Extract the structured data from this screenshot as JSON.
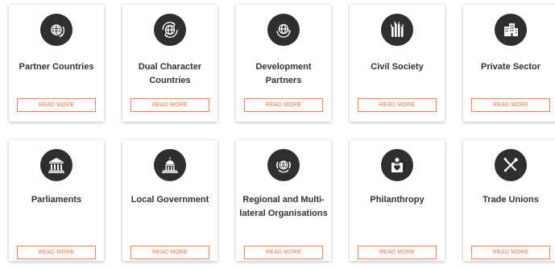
{
  "accent_color": "#ee6b3b",
  "icon_bg_color": "#2f2f2f",
  "cards": [
    {
      "title": "Partner Countries",
      "button": "READ MORE",
      "icon": "globe-refresh-icon"
    },
    {
      "title": "Dual Character Countries",
      "button": "READ MORE",
      "icon": "globe-cycle-icon"
    },
    {
      "title": "Development Partners",
      "button": "READ MORE",
      "icon": "globe-arrow-icon"
    },
    {
      "title": "Civil Society",
      "button": "READ MORE",
      "icon": "raised-hands-icon"
    },
    {
      "title": "Private Sector",
      "button": "READ MORE",
      "icon": "buildings-icon"
    },
    {
      "title": "Parliaments",
      "button": "READ MORE",
      "icon": "parliament-building-icon"
    },
    {
      "title": "Local Government",
      "button": "READ MORE",
      "icon": "capitol-dome-icon"
    },
    {
      "title": "Regional and Multi-lateral Organisations",
      "button": "READ MORE",
      "icon": "un-emblem-icon"
    },
    {
      "title": "Philanthropy",
      "button": "READ MORE",
      "icon": "donation-box-icon"
    },
    {
      "title": "Trade Unions",
      "button": "READ MORE",
      "icon": "crossed-tools-icon"
    }
  ]
}
